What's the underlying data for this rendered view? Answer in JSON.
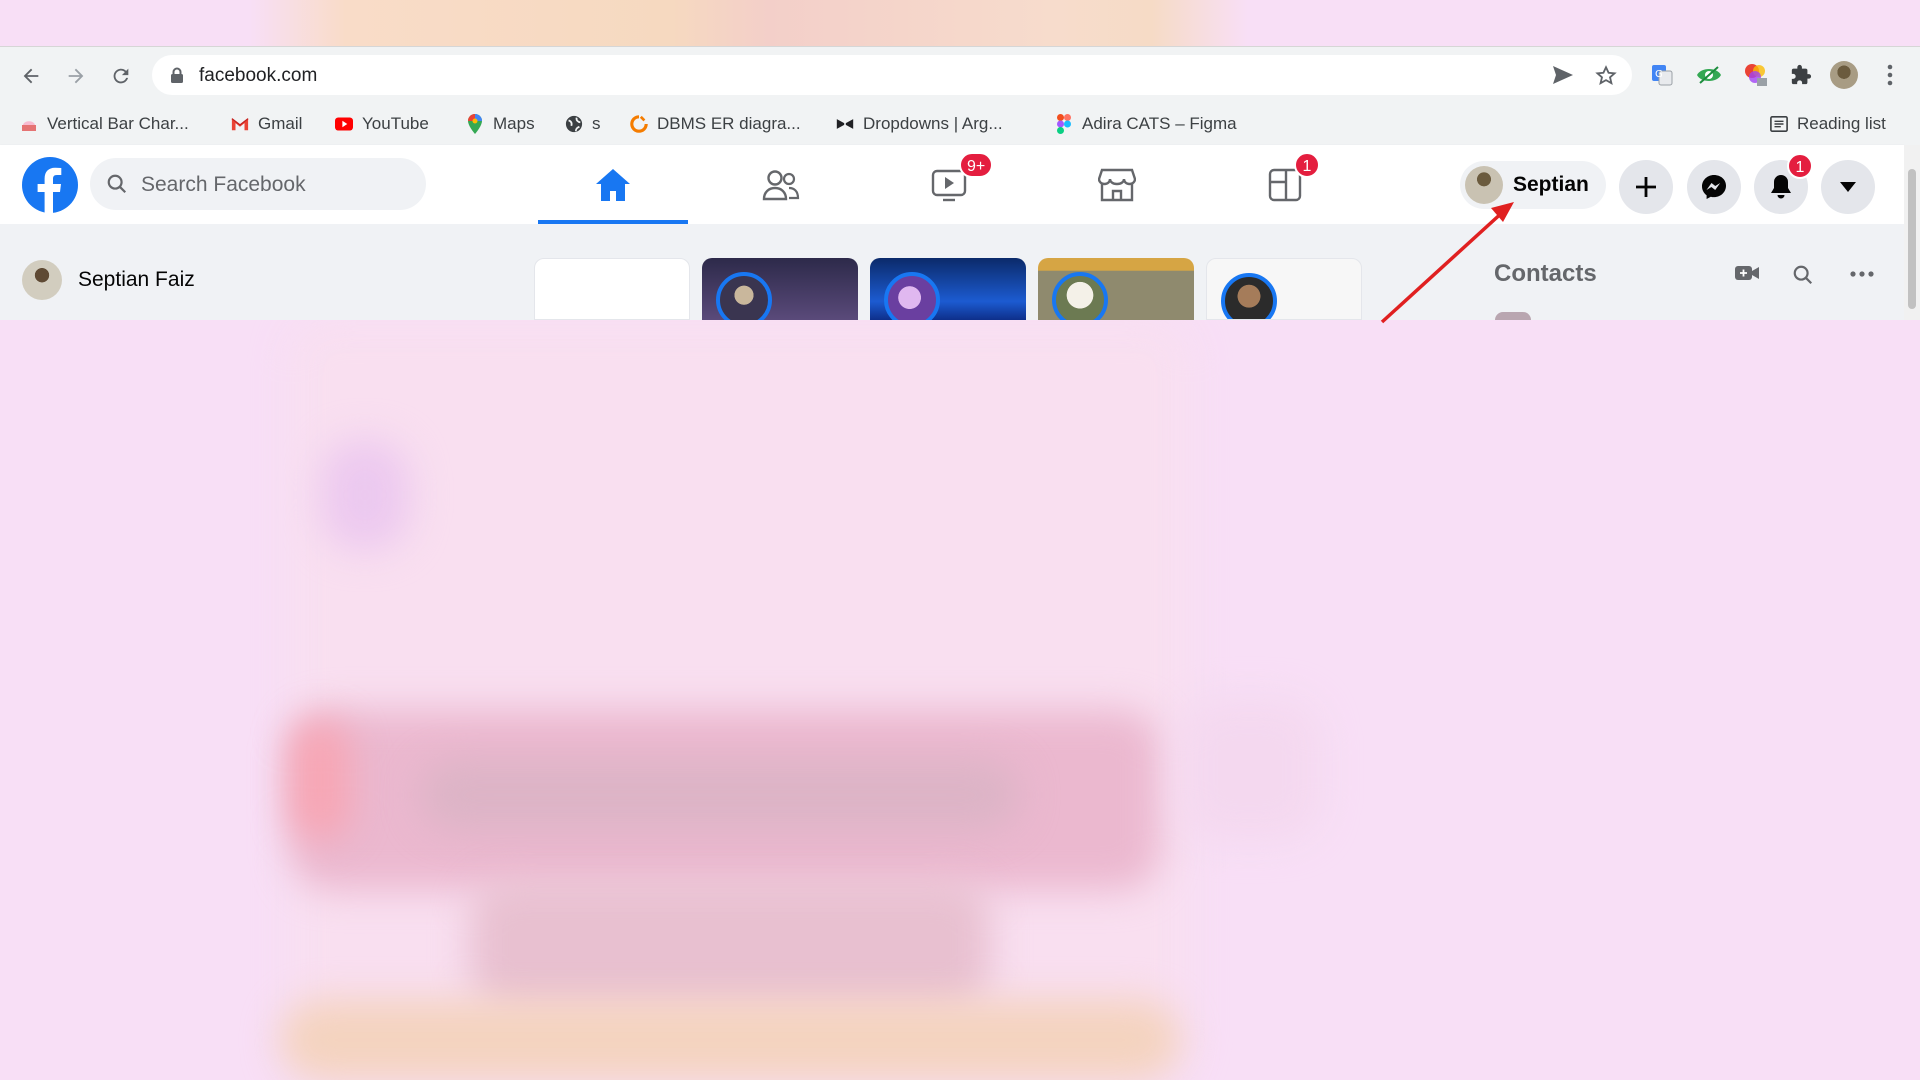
{
  "browser": {
    "url": "facebook.com",
    "bookmarks": [
      {
        "label": "Vertical Bar Char..."
      },
      {
        "label": "Gmail"
      },
      {
        "label": "YouTube"
      },
      {
        "label": "Maps"
      },
      {
        "label": "s"
      },
      {
        "label": "DBMS ER diagra..."
      },
      {
        "label": "Dropdowns | Arg..."
      },
      {
        "label": "Adira CATS – Figma"
      }
    ],
    "reading_list": "Reading list"
  },
  "facebook": {
    "search_placeholder": "Search Facebook",
    "watch_badge": "9+",
    "gaming_badge": "1",
    "notifications_badge": "1",
    "profile_short_name": "Septian",
    "profile_full_name": "Septian Faiz",
    "contacts_title": "Contacts",
    "accent_color": "#1877f2",
    "badge_color": "#e41e3f"
  },
  "annotation": {
    "arrow_color": "#e02020",
    "points_to": "profile-chip"
  }
}
